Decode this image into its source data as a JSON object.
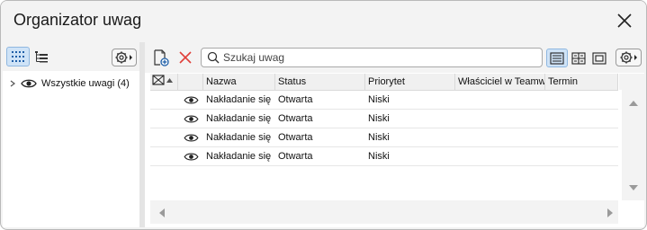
{
  "window": {
    "title": "Organizator uwag"
  },
  "left_panel": {
    "tree": {
      "label": "Wszystkie uwagi (4)"
    }
  },
  "toolbar": {
    "search_placeholder": "Szukaj uwag"
  },
  "table": {
    "columns": [
      "Nazwa",
      "Status",
      "Priorytet",
      "Właściciel w Teamwork",
      "Termin"
    ],
    "rows": [
      {
        "name": "Nakładanie się",
        "status": "Otwarta",
        "priority": "Niski",
        "owner": "",
        "due": ""
      },
      {
        "name": "Nakładanie się",
        "status": "Otwarta",
        "priority": "Niski",
        "owner": "",
        "due": ""
      },
      {
        "name": "Nakładanie się",
        "status": "Otwarta",
        "priority": "Niski",
        "owner": "",
        "due": ""
      },
      {
        "name": "Nakładanie się",
        "status": "Otwarta",
        "priority": "Niski",
        "owner": "",
        "due": ""
      }
    ]
  },
  "colors": {
    "accent": "#cfe3f7",
    "delete_red": "#e0403a",
    "icon_blue": "#1f5fa8"
  }
}
